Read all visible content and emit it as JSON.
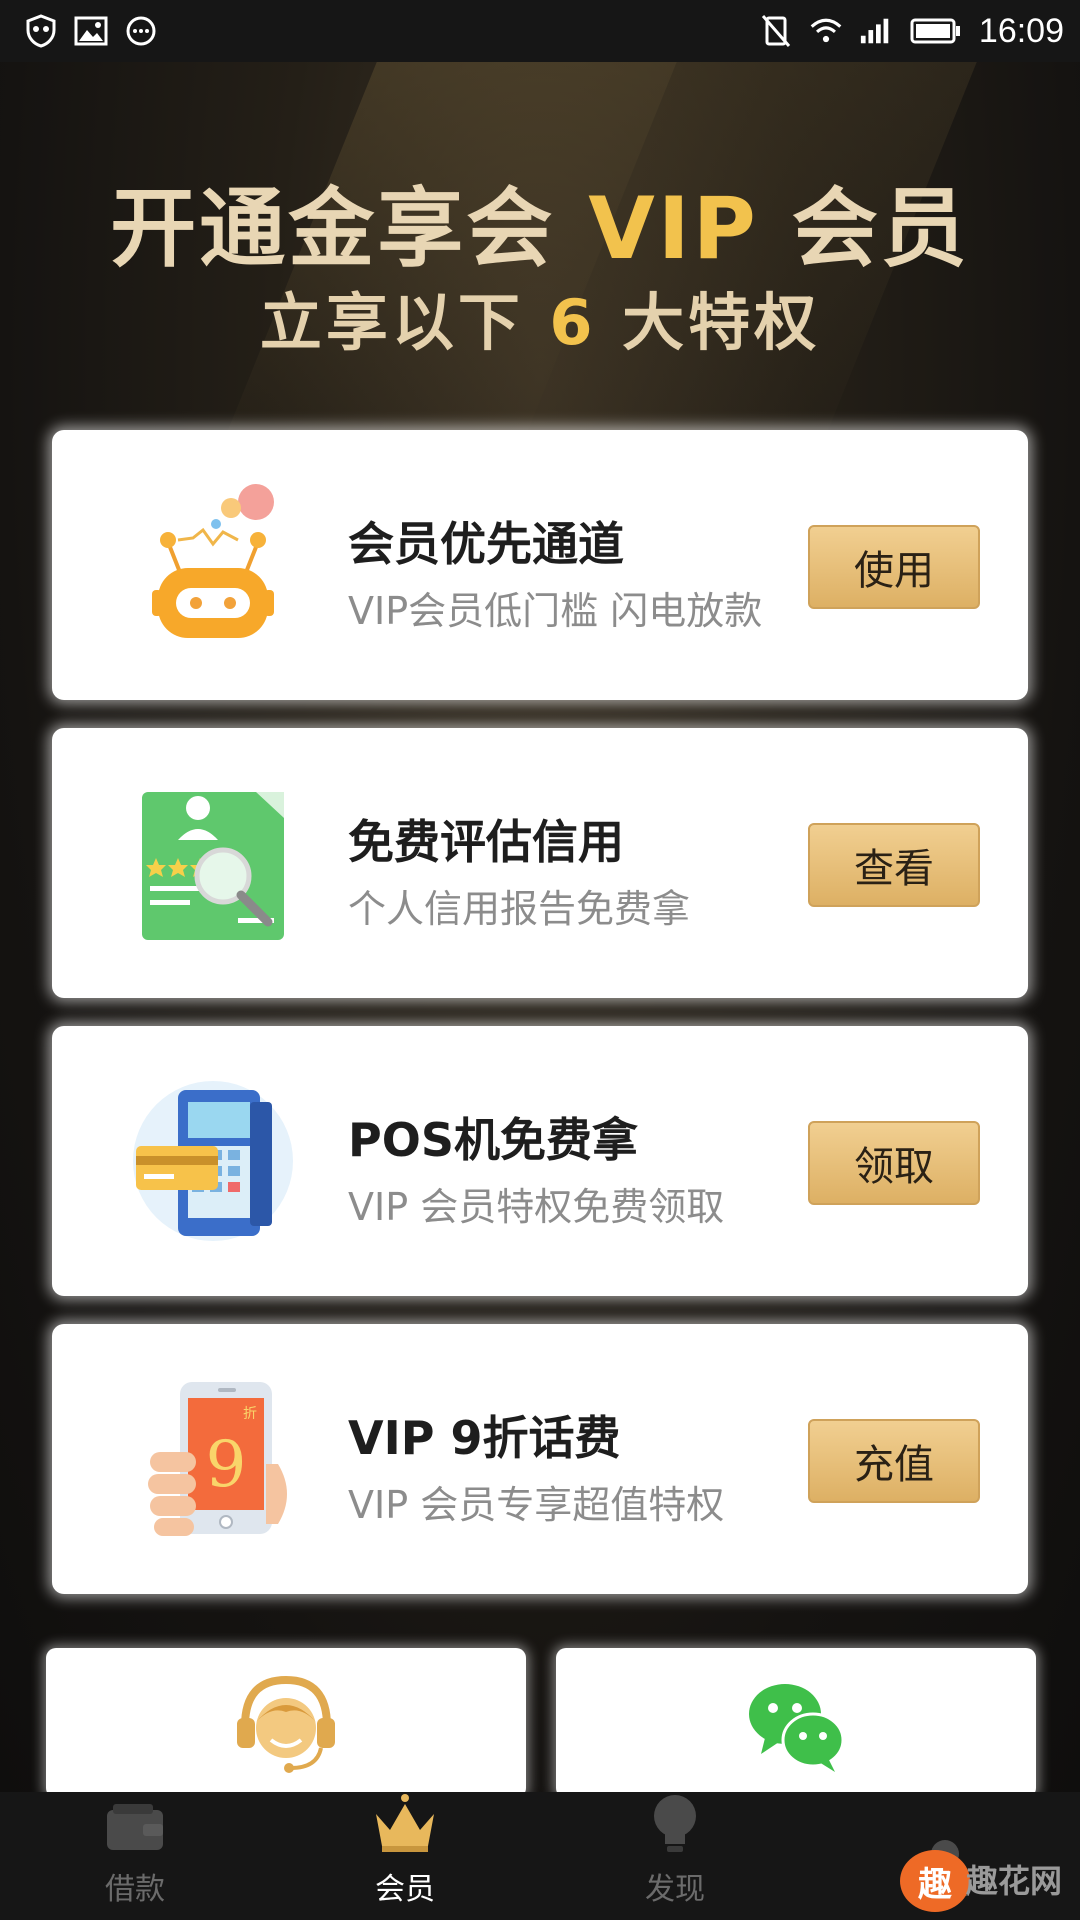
{
  "status_bar": {
    "time": "16:09",
    "left_icons": [
      "shield-icon",
      "image-icon",
      "chat-bubble-icon"
    ],
    "right_icons": [
      "no-sim-icon",
      "wifi-icon",
      "signal-icon",
      "battery-icon"
    ]
  },
  "hero": {
    "title_prefix": "开通金享会",
    "title_vip": "VIP",
    "title_suffix": "会员",
    "subtitle_prefix": "立享以下",
    "subtitle_num": "6",
    "subtitle_suffix": "大特权"
  },
  "cards": [
    {
      "title": "会员优先通道",
      "desc": "VIP会员低门槛 闪电放款",
      "button": "使用",
      "icon": "robot-icon"
    },
    {
      "title": "免费评估信用",
      "desc": "个人信用报告免费拿",
      "button": "查看",
      "icon": "credit-report-icon"
    },
    {
      "title": "POS机免费拿",
      "desc": "VIP 会员特权免费领取",
      "button": "领取",
      "icon": "pos-machine-icon"
    },
    {
      "title": "VIP 9折话费",
      "desc": "VIP 会员专享超值特权",
      "button": "充值",
      "icon": "phone-recharge-icon"
    }
  ],
  "mini_cards": [
    {
      "icon": "customer-service-icon"
    },
    {
      "icon": "wechat-icon"
    }
  ],
  "bottom_nav": {
    "items": [
      {
        "label": "借款",
        "icon": "wallet-icon"
      },
      {
        "label": "会员",
        "icon": "crown-icon"
      },
      {
        "label": "发现",
        "icon": "lightbulb-icon"
      },
      {
        "label": "",
        "icon": "user-icon"
      }
    ],
    "active_index": 1
  },
  "watermark": {
    "badge": "趣",
    "text": "趣花网"
  },
  "colors": {
    "gold": "#f2c24d",
    "button_gold": "#ddb064",
    "dark_bg": "#151311"
  }
}
